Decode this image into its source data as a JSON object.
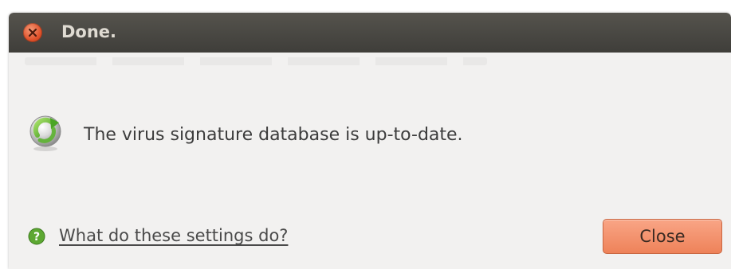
{
  "window": {
    "title": "Done."
  },
  "message": {
    "text": "The virus signature database is up-to-date.",
    "icon": "refresh-check-icon"
  },
  "help": {
    "link_text": "What do these settings do?",
    "icon": "help-icon"
  },
  "buttons": {
    "close_label": "Close"
  },
  "colors": {
    "titlebar": "#3f3e3a",
    "title_text": "#dfdbd2",
    "window_bg": "#f2f1f0",
    "close_button_bg": "#ee8259",
    "window_close_button": "#e0512a",
    "status_icon_green": "#6bbf2a",
    "help_icon_green": "#5da832"
  }
}
